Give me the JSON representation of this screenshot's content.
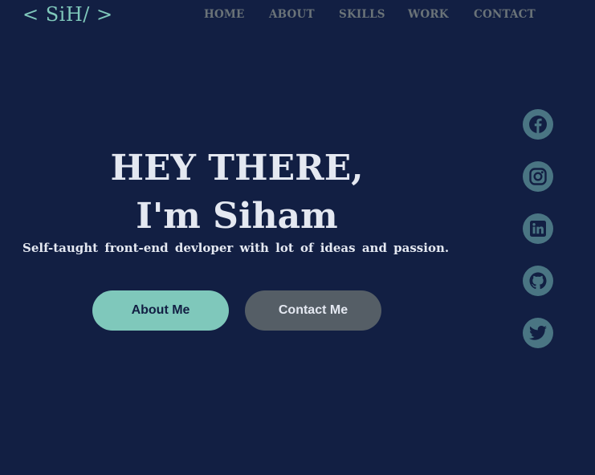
{
  "logo": {
    "text": "< SiH/ >"
  },
  "nav": {
    "home": "HOME",
    "about": "ABOUT",
    "skills": "SKILLS",
    "work": "WORK",
    "contact": "CONTACT"
  },
  "hero": {
    "line1": "HEY THERE,",
    "line2": "I'm Siham",
    "subtitle": "Self-taught front-end devloper with lot of ideas and passion."
  },
  "buttons": {
    "about": "About Me",
    "contact": "Contact Me"
  },
  "social": {
    "icons": [
      "facebook-icon",
      "instagram-icon",
      "linkedin-icon",
      "github-icon",
      "twitter-icon"
    ]
  },
  "colors": {
    "background": "#121f43",
    "accent": "#7fc8bb",
    "nav_text": "#6a7378",
    "hero_text": "#e4e8f1",
    "secondary_button": "#555e66",
    "social_circle": "#4a7583",
    "social_glyph": "#121f43"
  }
}
